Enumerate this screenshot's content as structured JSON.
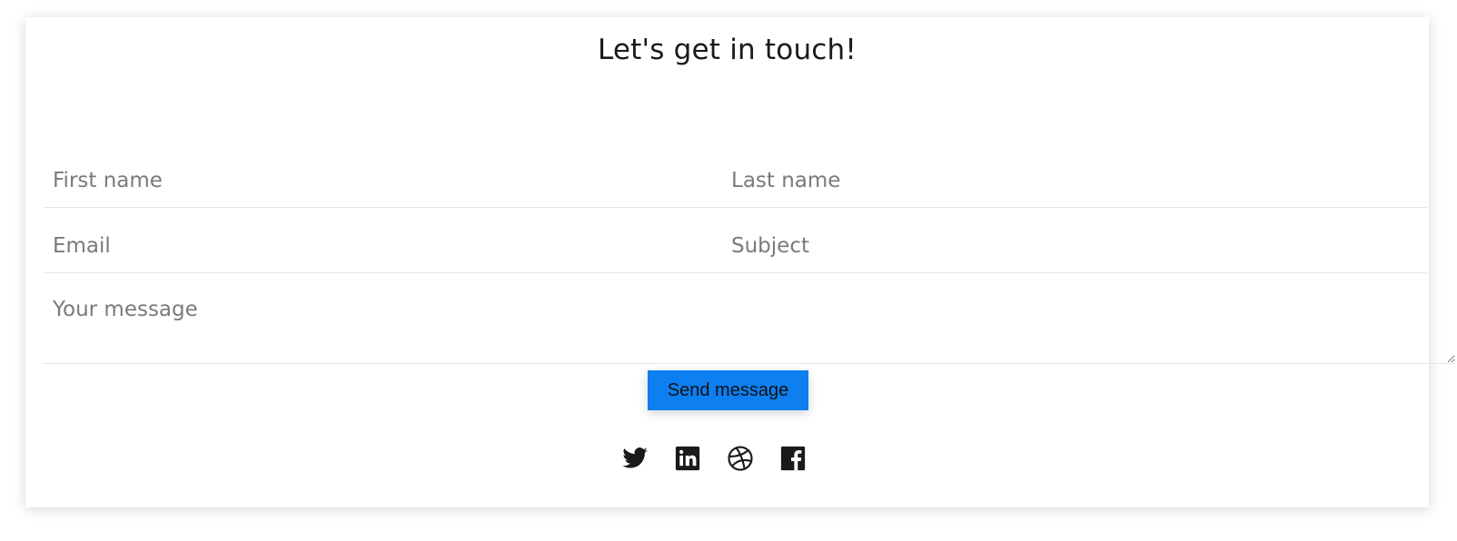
{
  "title": "Let's get in touch!",
  "form": {
    "first_name_placeholder": "First name",
    "last_name_placeholder": "Last name",
    "email_placeholder": "Email",
    "subject_placeholder": "Subject",
    "message_placeholder": "Your message",
    "send_label": "Send message"
  },
  "social": [
    {
      "icon": "twitter-icon"
    },
    {
      "icon": "linkedin-icon"
    },
    {
      "icon": "dribbble-icon"
    },
    {
      "icon": "facebook-icon"
    }
  ],
  "colors": {
    "accent": "#0d7ff0",
    "text": "#1a1a1a",
    "placeholder": "#7a7a7a"
  }
}
